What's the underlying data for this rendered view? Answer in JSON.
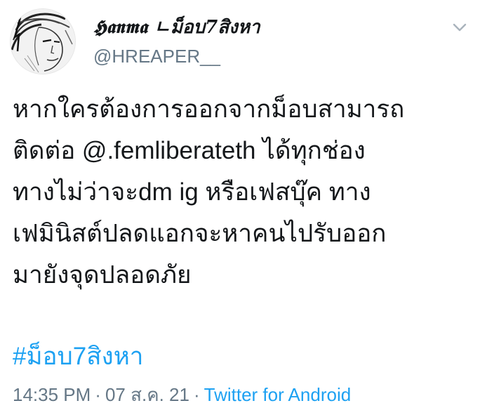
{
  "author": {
    "display_name": "𝕳𝖆𝖓𝖒𝖆 ㄴม็อบ7สิงหา",
    "handle": "@HREAPER__"
  },
  "icons": {
    "more": "chevron-down-icon",
    "avatar": "avatar-sketch-portrait"
  },
  "tweet": {
    "lines": [
      "หากใครต้องการออกจากม็อบสามารถ",
      "ติดต่อ @.femliberateth ได้ทุกช่อง",
      "ทางไม่ว่าจะdm ig หรือเฟสบุ๊ค ทาง",
      "เฟมินิสต์ปลดแอกจะหาคนไปรับออก",
      "มายังจุดปลอดภัย"
    ],
    "hashtag": "#ม็อบ7สิงหา"
  },
  "meta": {
    "time": "14:35 PM",
    "date": "07 ส.ค. 21",
    "separator": "·",
    "source": "Twitter for Android"
  },
  "colors": {
    "text": "#14171a",
    "muted": "#657786",
    "link": "#1da1f2"
  }
}
